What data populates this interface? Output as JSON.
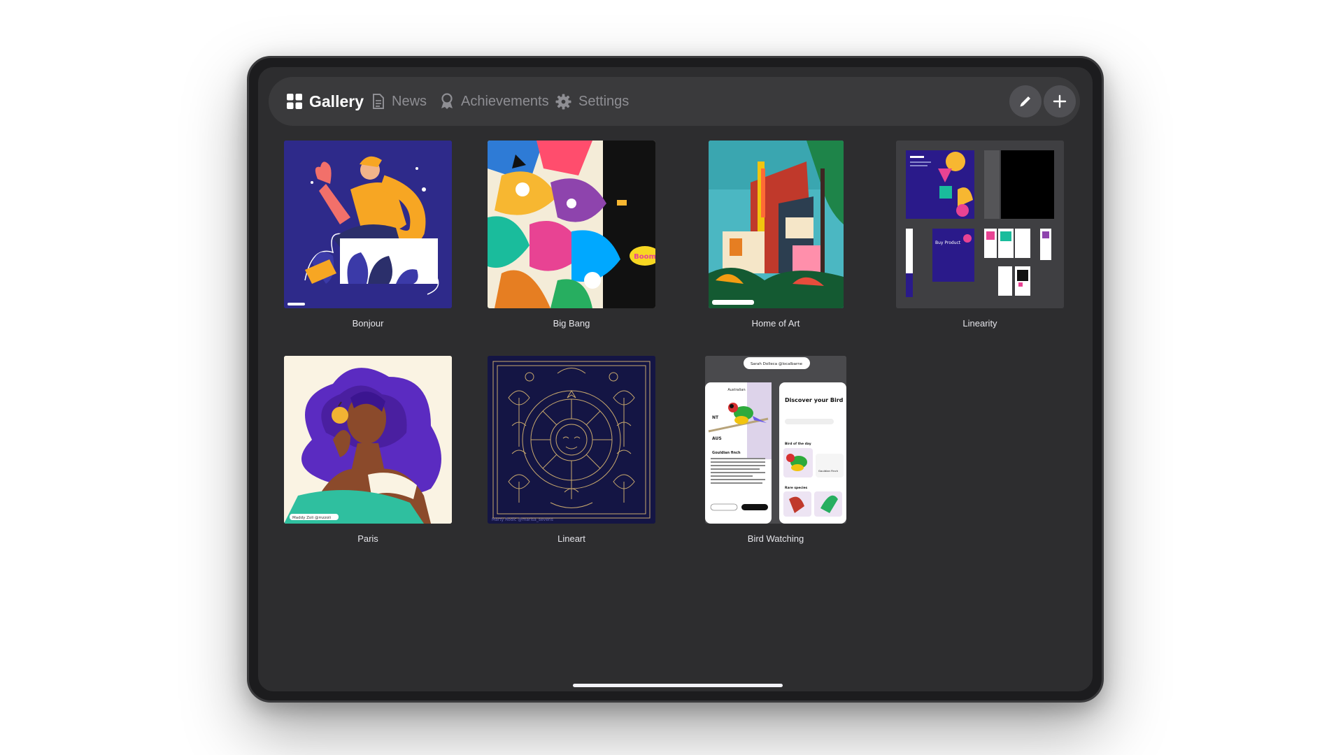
{
  "nav": {
    "tabs": [
      {
        "label": "Gallery",
        "icon": "grid-icon",
        "active": true
      },
      {
        "label": "News",
        "icon": "document-icon",
        "active": false
      },
      {
        "label": "Achievements",
        "icon": "award-icon",
        "active": false
      },
      {
        "label": "Settings",
        "icon": "gear-icon",
        "active": false
      }
    ],
    "actions": [
      "pencil-icon",
      "plus-icon"
    ]
  },
  "gallery": {
    "items": [
      {
        "title": "Bonjour"
      },
      {
        "title": "Big Bang"
      },
      {
        "title": "Home of Art"
      },
      {
        "title": "Linearity"
      },
      {
        "title": "Paris"
      },
      {
        "title": "Lineart"
      },
      {
        "title": "Bird Watching"
      }
    ]
  },
  "thumbs": {
    "bonjour_credit": "",
    "home_credit": "",
    "paris_credit": "Maddy Zoli @mzzoli",
    "lineart_credit": "Marty Rodic @marisa_sevens",
    "bigbang_sticker": "Boom",
    "bird": {
      "pill": "Sarah Dolleca @localbarne",
      "origin": "Australian",
      "from": "NT",
      "to": "AUS",
      "species": "Gouldian finch",
      "discover": "Discover your Bird",
      "bird_of_day": "Bird of the day",
      "rare": "Rare species",
      "card_name": "Gouldian Finch"
    },
    "linearity_headline": "Buy Product"
  },
  "colors": {
    "screen": "#2d2d2f",
    "bar": "#3a3a3c",
    "active": "#ffffff",
    "inactive": "#8e8e93"
  }
}
